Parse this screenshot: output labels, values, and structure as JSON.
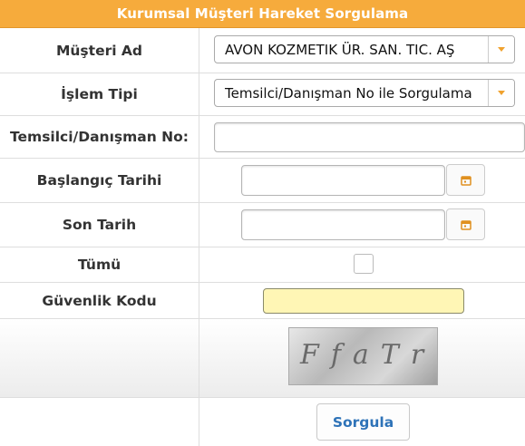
{
  "header": {
    "title": "Kurumsal Müşteri Hareket Sorgulama"
  },
  "form": {
    "customer": {
      "label": "Müşteri Ad",
      "value": "AVON KOZMETIK ÜR. SAN. TIC. AŞ"
    },
    "transaction_type": {
      "label": "İşlem Tipi",
      "value": "Temsilci/Danışman No ile Sorgulama"
    },
    "rep_no": {
      "label": "Temsilci/Danışman No:",
      "value": ""
    },
    "start_date": {
      "label": "Başlangıç Tarihi",
      "value": ""
    },
    "end_date": {
      "label": "Son Tarih",
      "value": ""
    },
    "all": {
      "label": "Tümü",
      "checked": false
    },
    "security_code": {
      "label": "Güvenlik Kodu",
      "value": ""
    },
    "captcha": {
      "text": "FfaTr"
    },
    "submit": {
      "label": "Sorgula"
    }
  },
  "colors": {
    "header": "#f6ab3c",
    "accent": "#f0a22e",
    "captcha_field": "#fff6b5",
    "button_text": "#2e73b8"
  }
}
